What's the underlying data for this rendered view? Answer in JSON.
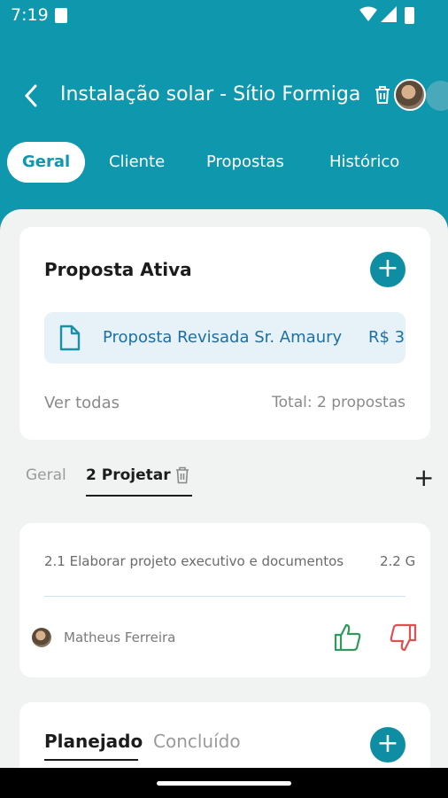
{
  "status_bar": {
    "time": "7:19"
  },
  "app_bar": {
    "title": "Instalação solar - Sítio Formiga"
  },
  "tabs": [
    {
      "label": "Geral",
      "active": true
    },
    {
      "label": "Cliente",
      "active": false
    },
    {
      "label": "Propostas",
      "active": false
    },
    {
      "label": "Histórico",
      "active": false
    }
  ],
  "proposta_card": {
    "title": "Proposta Ativa",
    "proposal_name": "Proposta Revisada Sr. Amaury",
    "proposal_value": "R$ 3",
    "ver_todas": "Ver todas",
    "total": "Total: 2 propostas"
  },
  "sub_tabs": {
    "geral": "Geral",
    "projetar": "2 Projetar"
  },
  "task_card": {
    "task": "2.1 Elaborar projeto executivo e documentos",
    "code": "2.2 G",
    "user": "Matheus Ferreira"
  },
  "status_card": {
    "planejado": "Planejado",
    "concluido": "Concluído"
  },
  "colors": {
    "primary": "#0f97ad",
    "link": "#1f6fa3",
    "like": "#2e9a5b",
    "dislike": "#e05050"
  }
}
